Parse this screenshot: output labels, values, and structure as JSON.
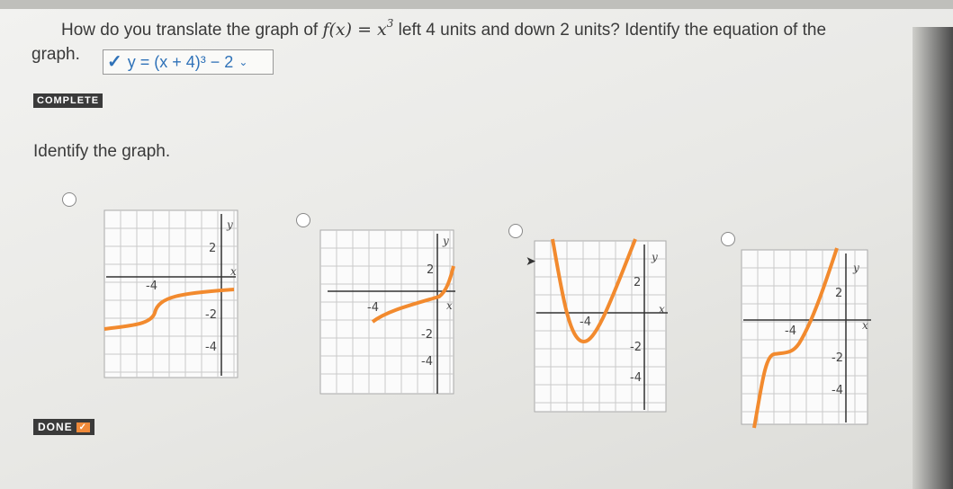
{
  "question": {
    "prefix": "How do you translate the graph of ",
    "func": "f(x) = x",
    "exp": "3",
    "suffix": " left 4 units and down 2 units? Identify the equation of the",
    "graph_word": "graph."
  },
  "answer": {
    "text": "y = (x + 4)³ − 2"
  },
  "status": {
    "complete": "COMPLETE"
  },
  "identify": "Identify the graph.",
  "done": "DONE",
  "colors": {
    "curve": "#f28a2e",
    "accent": "#2f72b8"
  },
  "graphs": [
    {
      "id": "a",
      "ylabel": "y",
      "xlabel": "x",
      "ticks": {
        "y_pos": "2",
        "x_neg": "-4",
        "y_neg2": "-2",
        "y_neg4": "-4"
      }
    },
    {
      "id": "b",
      "ylabel": "y",
      "xlabel": "x",
      "ticks": {
        "y_pos": "2",
        "x_neg": "-4",
        "y_neg2": "-2",
        "y_neg4": "-4"
      }
    },
    {
      "id": "c",
      "ylabel": "y",
      "xlabel": "x",
      "ticks": {
        "y_pos": "2",
        "x_neg": "-4",
        "y_neg2": "-2",
        "y_neg4": "-4"
      }
    },
    {
      "id": "d",
      "ylabel": "y",
      "xlabel": "x",
      "ticks": {
        "y_pos": "2",
        "x_neg": "-4",
        "y_neg2": "-2",
        "y_neg4": "-4"
      }
    }
  ]
}
